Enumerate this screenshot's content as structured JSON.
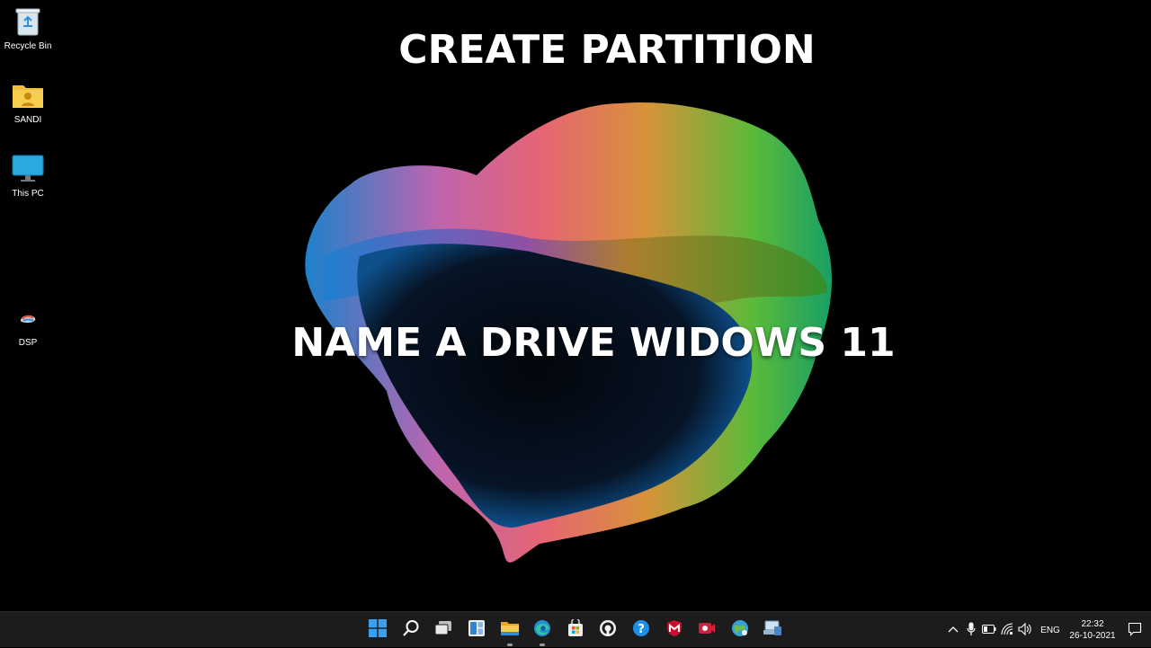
{
  "overlay": {
    "title_top": "CREATE PARTITION",
    "title_mid": "NAME A DRIVE WIDOWS 11"
  },
  "desktop_icons": [
    {
      "label": "Recycle Bin",
      "icon": "recycle-bin-icon"
    },
    {
      "label": "SANDI",
      "icon": "user-folder-icon"
    },
    {
      "label": "This PC",
      "icon": "monitor-icon"
    },
    {
      "label": "DSP",
      "icon": "app-icon"
    }
  ],
  "taskbar": {
    "apps": [
      {
        "name": "start",
        "icon": "windows-logo-icon"
      },
      {
        "name": "search",
        "icon": "search-icon"
      },
      {
        "name": "task-view",
        "icon": "task-view-icon"
      },
      {
        "name": "widgets",
        "icon": "widgets-icon"
      },
      {
        "name": "file-explorer",
        "icon": "folder-icon",
        "running": true
      },
      {
        "name": "edge",
        "icon": "edge-icon",
        "running": true
      },
      {
        "name": "store",
        "icon": "store-icon"
      },
      {
        "name": "app-circle",
        "icon": "circle-app-icon"
      },
      {
        "name": "help",
        "icon": "help-icon"
      },
      {
        "name": "mcafee",
        "icon": "mcafee-icon"
      },
      {
        "name": "recorder",
        "icon": "camera-icon"
      },
      {
        "name": "network-app",
        "icon": "globe-icon"
      },
      {
        "name": "remote-app",
        "icon": "computer-icon"
      }
    ],
    "tray": {
      "language": "ENG",
      "time": "22:32",
      "date": "26-10-2021"
    }
  },
  "colors": {
    "taskbar_bg": "#1c1c1c",
    "desktop_bg": "#000000",
    "accent_blue": "#0078d4"
  }
}
